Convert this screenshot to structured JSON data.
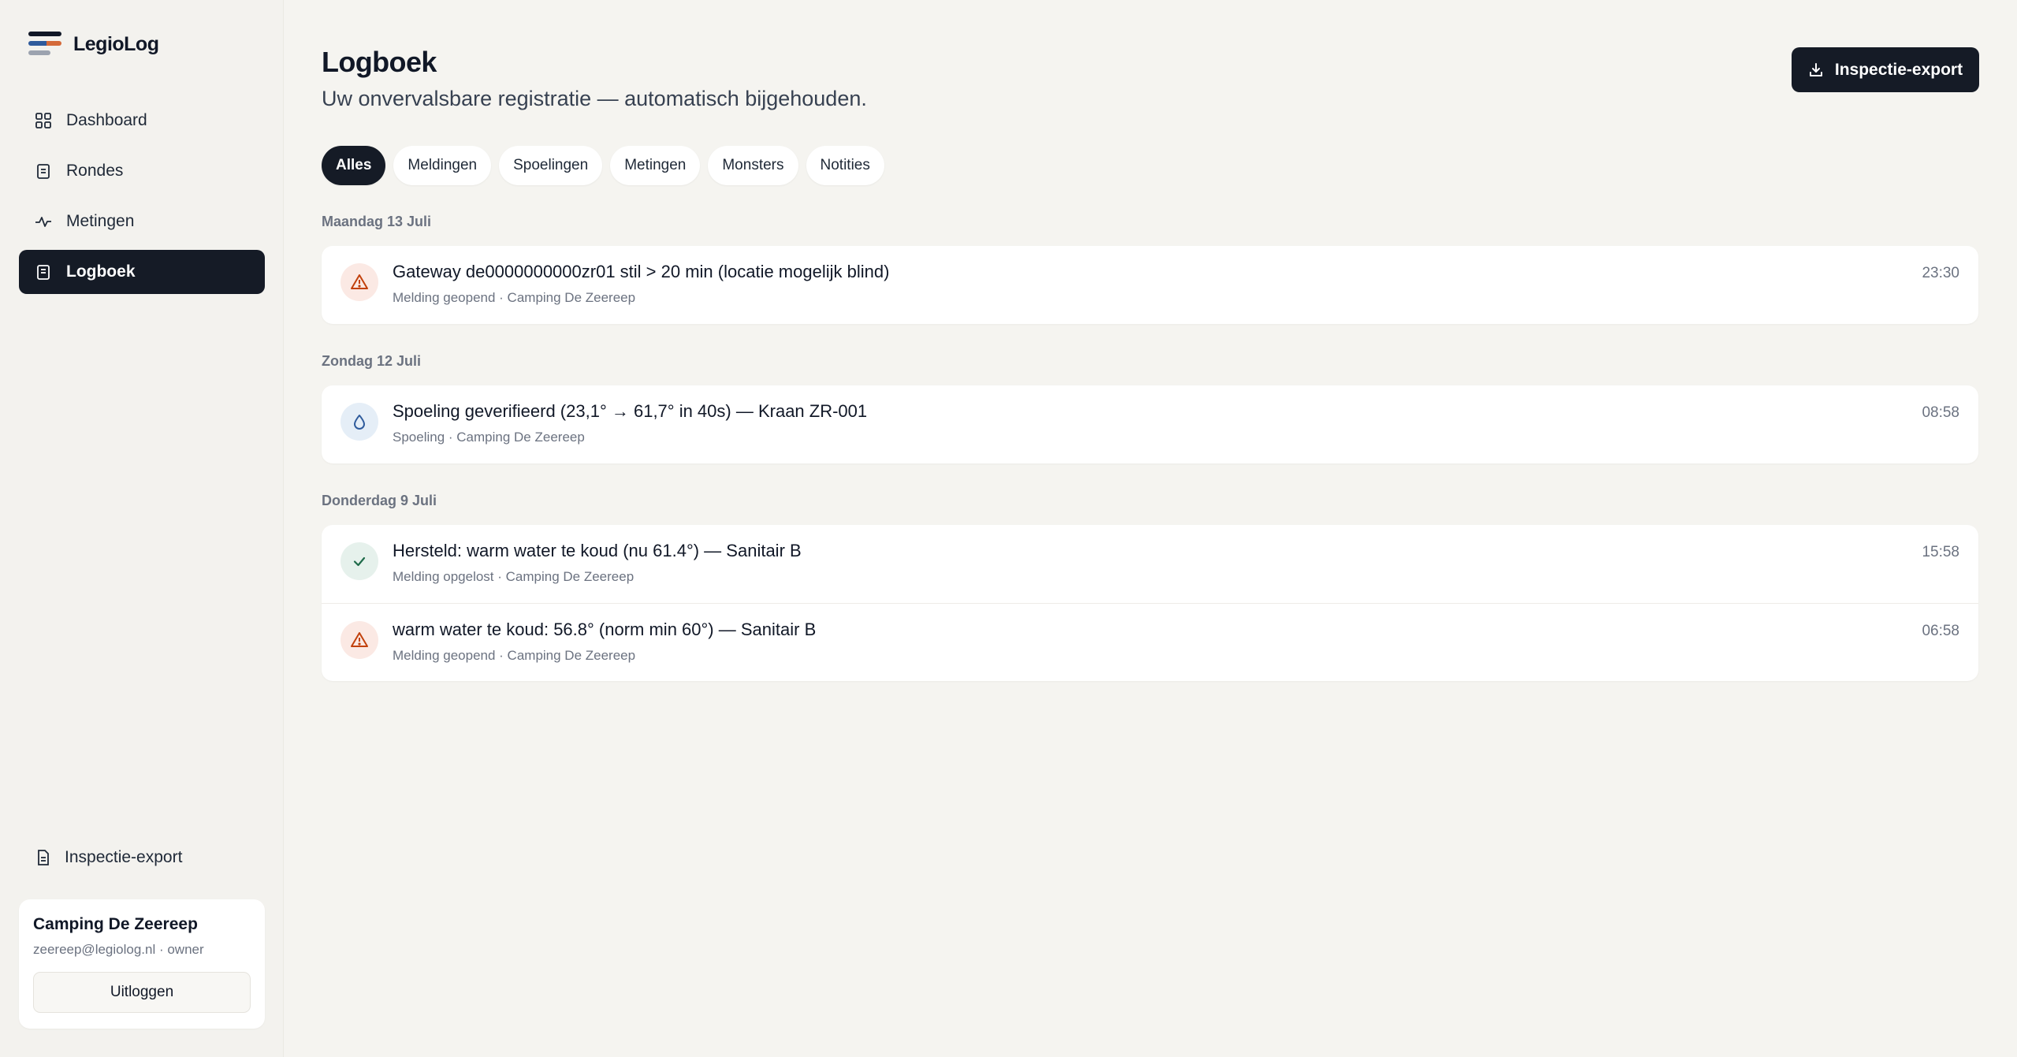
{
  "brand": {
    "name": "LegioLog"
  },
  "sidebar": {
    "items": [
      {
        "label": "Dashboard",
        "icon": "grid-icon"
      },
      {
        "label": "Rondes",
        "icon": "clipboard-icon"
      },
      {
        "label": "Metingen",
        "icon": "pulse-icon"
      },
      {
        "label": "Logboek",
        "icon": "book-icon",
        "active": true
      }
    ],
    "export_label": "Inspectie-export",
    "account": {
      "name": "Camping De Zeereep",
      "meta": "zeereep@legiolog.nl · owner",
      "logout_label": "Uitloggen"
    }
  },
  "header": {
    "title": "Logboek",
    "subtitle": "Uw onvervalsbare registratie — automatisch bijgehouden.",
    "export_label": "Inspectie-export"
  },
  "filters": [
    {
      "label": "Alles",
      "active": true
    },
    {
      "label": "Meldingen"
    },
    {
      "label": "Spoelingen"
    },
    {
      "label": "Metingen"
    },
    {
      "label": "Monsters"
    },
    {
      "label": "Notities"
    }
  ],
  "days": [
    {
      "label": "Maandag 13 Juli",
      "entries": [
        {
          "type": "warning",
          "title": "Gateway de0000000000zr01 stil > 20 min (locatie mogelijk blind)",
          "meta": "Melding geopend · Camping De Zeereep",
          "time": "23:30"
        }
      ]
    },
    {
      "label": "Zondag 12 Juli",
      "entries": [
        {
          "type": "flush",
          "title": "Spoeling geverifieerd (23,1° → 61,7° in 40s) — Kraan ZR-001",
          "meta": "Spoeling · Camping De Zeereep",
          "time": "08:58"
        }
      ]
    },
    {
      "label": "Donderdag 9 Juli",
      "entries": [
        {
          "type": "resolved",
          "title": "Hersteld: warm water te koud (nu 61.4°) — Sanitair B",
          "meta": "Melding opgelost · Camping De Zeereep",
          "time": "15:58"
        },
        {
          "type": "warning",
          "title": "warm water te koud: 56.8° (norm min 60°) — Sanitair B",
          "meta": "Melding geopend · Camping De Zeereep",
          "time": "06:58"
        }
      ]
    }
  ],
  "colors": {
    "dark": "#151b26",
    "background": "#f5f4f0",
    "warning": "#c2410c",
    "water": "#2f5b9c",
    "resolved": "#1f6b4a"
  }
}
